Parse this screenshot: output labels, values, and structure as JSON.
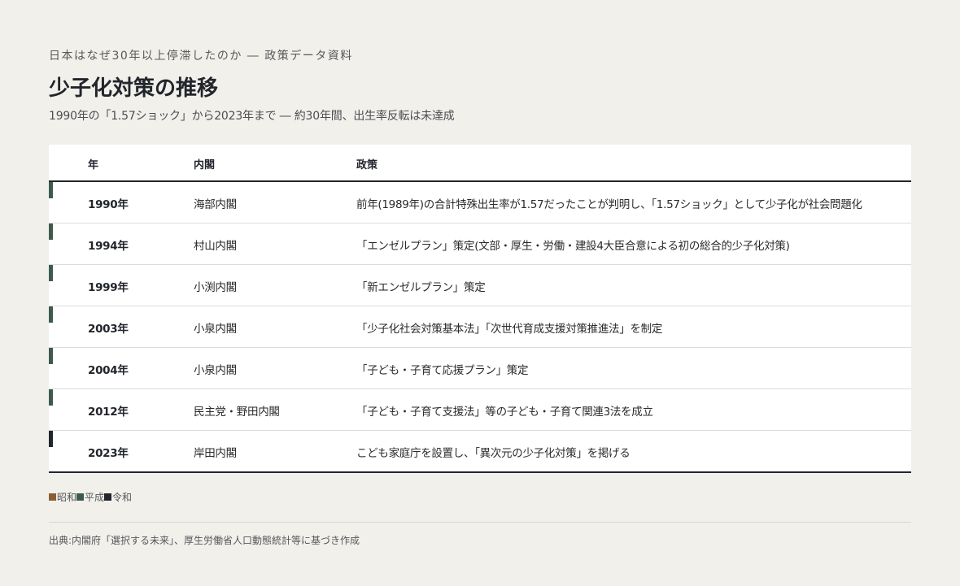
{
  "header": {
    "eyebrow": "日本はなぜ30年以上停滞したのか ― 政策データ資料",
    "title": "少子化対策の推移",
    "subtitle": "1990年の「1.57ショック」から2023年まで ― 約30年間、出生率反転は未達成"
  },
  "table": {
    "columns": [
      "年",
      "内閣",
      "政策"
    ],
    "rows": [
      {
        "year": "1990年",
        "cabinet": "海部内閣",
        "policy": "前年(1989年)の合計特殊出生率が1.57だったことが判明し、「1.57ショック」として少子化が社会問題化",
        "era": "heisei"
      },
      {
        "year": "1994年",
        "cabinet": "村山内閣",
        "policy": "「エンゼルプラン」策定(文部・厚生・労働・建設4大臣合意による初の総合的少子化対策)",
        "era": "heisei"
      },
      {
        "year": "1999年",
        "cabinet": "小渕内閣",
        "policy": "「新エンゼルプラン」策定",
        "era": "heisei"
      },
      {
        "year": "2003年",
        "cabinet": "小泉内閣",
        "policy": "「少子化社会対策基本法」「次世代育成支援対策推進法」を制定",
        "era": "heisei"
      },
      {
        "year": "2004年",
        "cabinet": "小泉内閣",
        "policy": "「子ども・子育て応援プラン」策定",
        "era": "heisei"
      },
      {
        "year": "2012年",
        "cabinet": "民主党・野田内閣",
        "policy": "「子ども・子育て支援法」等の子ども・子育て関連3法を成立",
        "era": "heisei"
      },
      {
        "year": "2023年",
        "cabinet": "岸田内閣",
        "policy": "こども家庭庁を設置し、「異次元の少子化対策」を掲げる",
        "era": "reiwa"
      }
    ]
  },
  "legend": {
    "items": [
      {
        "label": "昭和",
        "color": "#8b5e34"
      },
      {
        "label": "平成",
        "color": "#3e5a4f"
      },
      {
        "label": "令和",
        "color": "#22252b"
      }
    ]
  },
  "era_colors": {
    "showa": "#8b5e34",
    "heisei": "#3e5a4f",
    "reiwa": "#22252b"
  },
  "footer": {
    "source": "出典:内閣府「選択する未来」、厚生労働省人口動態統計等に基づき作成"
  }
}
